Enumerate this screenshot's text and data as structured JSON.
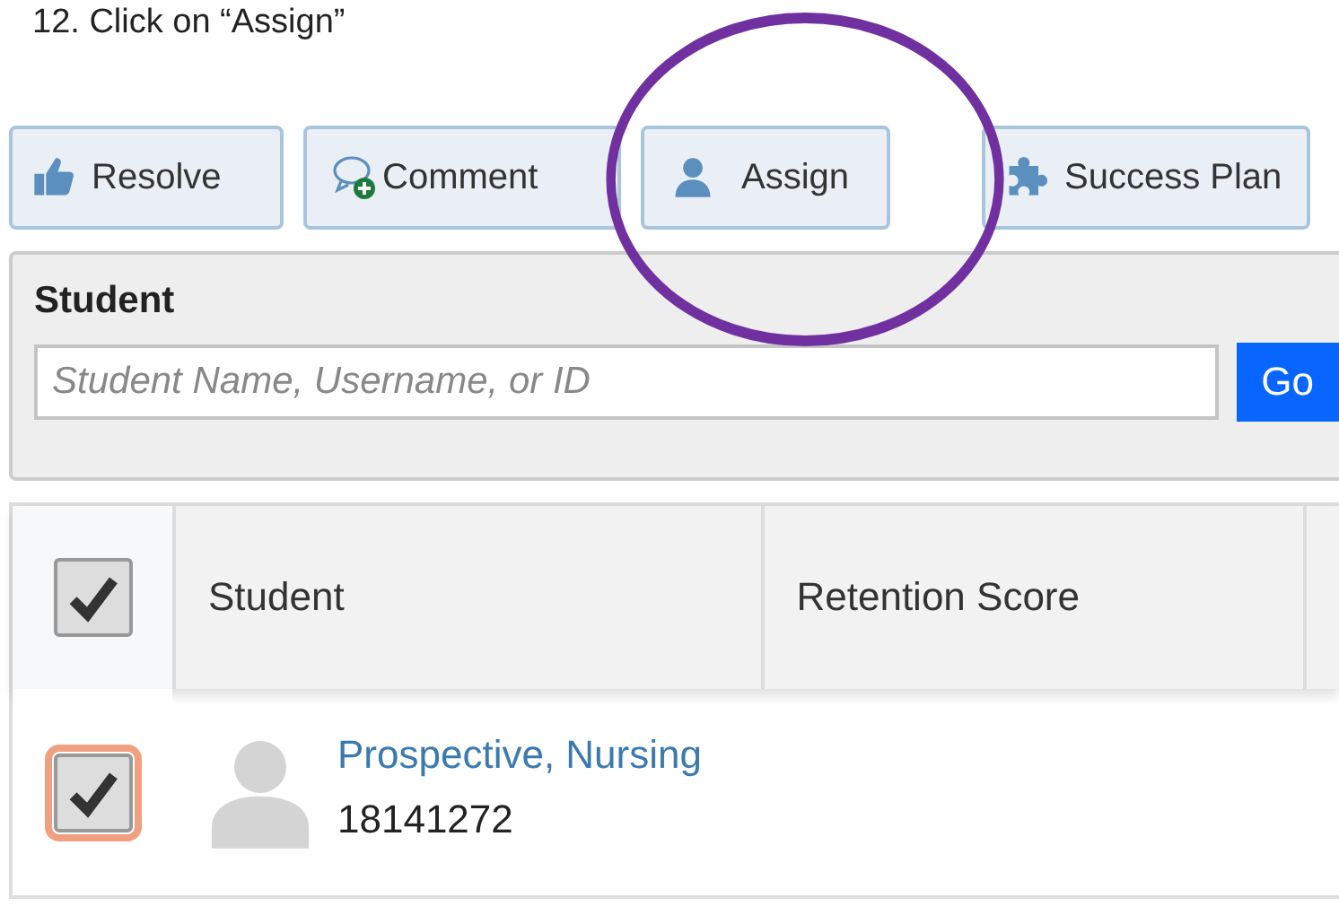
{
  "instruction": "12.  Click on “Assign”",
  "toolbar": [
    {
      "label": "Resolve"
    },
    {
      "label": "Comment"
    },
    {
      "label": "Assign"
    },
    {
      "label": "Success Plan"
    }
  ],
  "annotation": {
    "kind": "ellipse",
    "color": "#7030a0"
  },
  "search": {
    "label": "Student",
    "placeholder": "Student Name, Username, or ID",
    "button": "Go"
  },
  "table": {
    "select_all": {
      "checked": true
    },
    "columns": [
      "Student",
      "Retention Score"
    ],
    "rows": [
      {
        "checked": true,
        "focused": true,
        "name": "Prospective, Nursing",
        "id": "18141272"
      }
    ]
  }
}
